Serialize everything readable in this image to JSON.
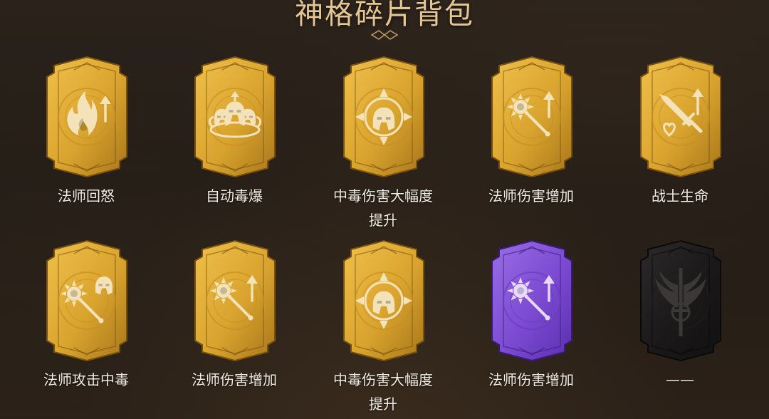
{
  "header": {
    "title": "神格碎片背包"
  },
  "colors": {
    "gold": "#d9a42e",
    "gold_dark": "#a8761a",
    "emblem": "#f4e2b8",
    "purple": "#7b4ad1",
    "locked": "#1a1818"
  },
  "cards": [
    {
      "label": "法师回怒",
      "style": "gold",
      "icon": "fire-up-icon"
    },
    {
      "label": "自动毒爆",
      "style": "gold",
      "icon": "triple-helmet-icon"
    },
    {
      "label": "中毒伤害大幅度提升",
      "style": "gold",
      "icon": "compass-helmet-icon"
    },
    {
      "label": "法师伤害增加",
      "style": "gold",
      "icon": "mace-up-icon"
    },
    {
      "label": "战士生命",
      "style": "gold",
      "icon": "sword-heart-icon"
    },
    {
      "label": "法师攻击中毒",
      "style": "gold",
      "icon": "mace-helmet-icon"
    },
    {
      "label": "法师伤害增加",
      "style": "gold",
      "icon": "mace-up-icon"
    },
    {
      "label": "中毒伤害大幅度提升",
      "style": "gold",
      "icon": "compass-helmet-icon"
    },
    {
      "label": "法师伤害增加",
      "style": "purple",
      "icon": "mace-up-icon"
    },
    {
      "label": "——",
      "style": "locked",
      "icon": "winged-sword-icon"
    }
  ]
}
